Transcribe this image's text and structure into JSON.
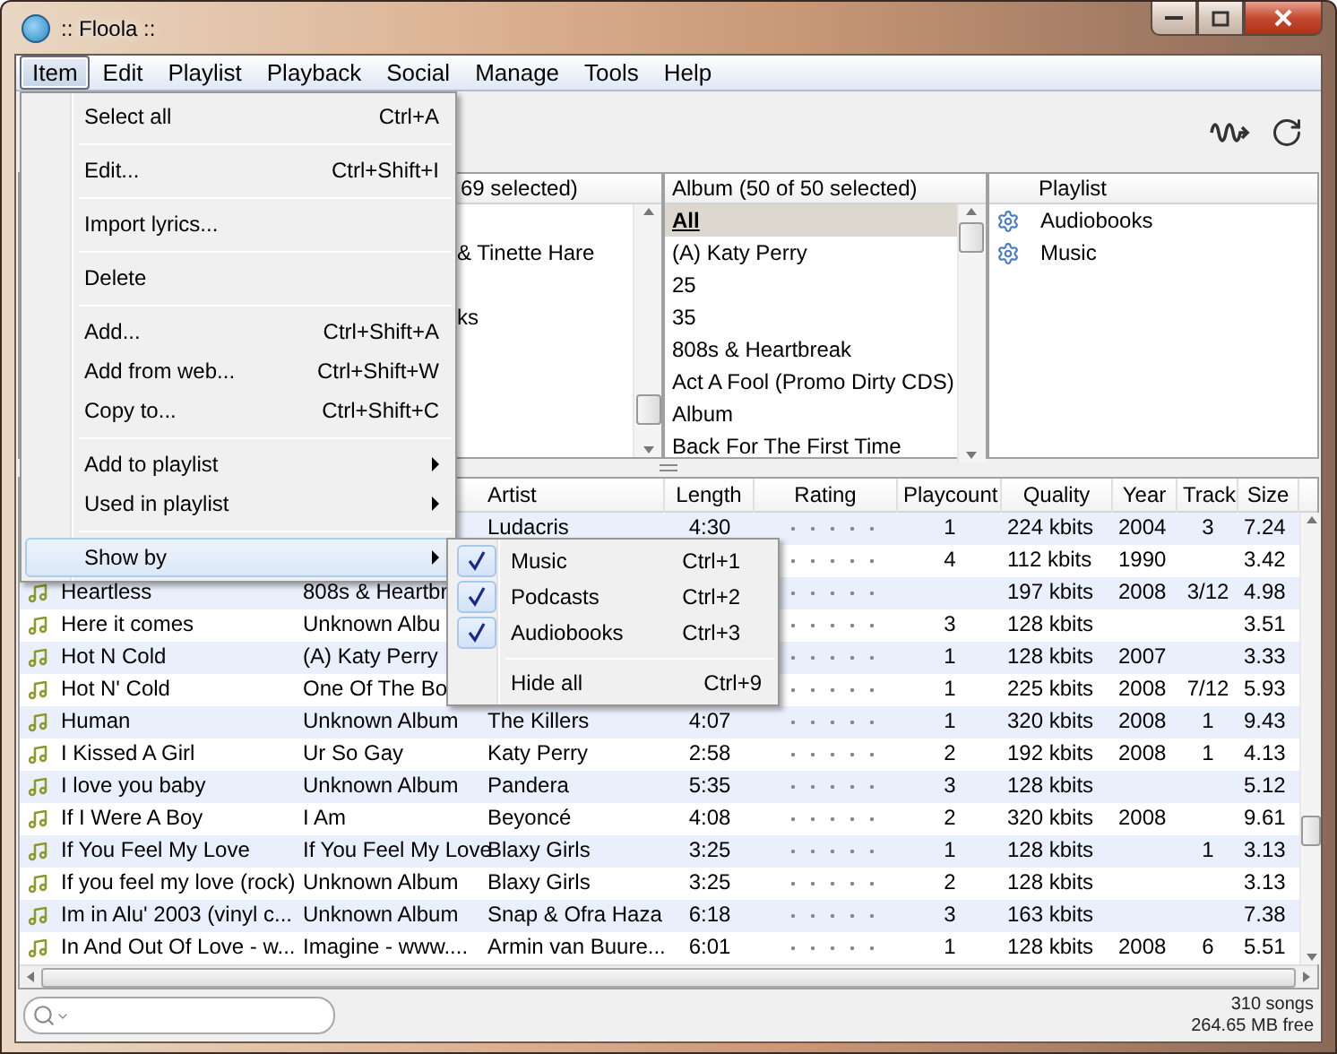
{
  "window": {
    "title": ":: Floola ::"
  },
  "menu_bar": [
    {
      "label": "Item",
      "selected": true
    },
    {
      "label": "Edit",
      "selected": false
    },
    {
      "label": "Playlist",
      "selected": false
    },
    {
      "label": "Playback",
      "selected": false
    },
    {
      "label": "Social",
      "selected": false
    },
    {
      "label": "Manage",
      "selected": false
    },
    {
      "label": "Tools",
      "selected": false
    },
    {
      "label": "Help",
      "selected": false
    }
  ],
  "item_menu": [
    {
      "kind": "item",
      "label": "Select all",
      "shortcut": "Ctrl+A",
      "highlighted": false
    },
    {
      "kind": "separator"
    },
    {
      "kind": "item",
      "label": "Edit...",
      "shortcut": "Ctrl+Shift+I",
      "highlighted": false
    },
    {
      "kind": "separator"
    },
    {
      "kind": "item",
      "label": "Import lyrics...",
      "highlighted": false
    },
    {
      "kind": "separator"
    },
    {
      "kind": "item",
      "label": "Delete",
      "highlighted": false
    },
    {
      "kind": "separator"
    },
    {
      "kind": "item",
      "label": "Add...",
      "shortcut": "Ctrl+Shift+A",
      "highlighted": false
    },
    {
      "kind": "item",
      "label": "Add from web...",
      "shortcut": "Ctrl+Shift+W",
      "highlighted": false
    },
    {
      "kind": "item",
      "label": "Copy to...",
      "shortcut": "Ctrl+Shift+C",
      "highlighted": false
    },
    {
      "kind": "separator"
    },
    {
      "kind": "submenu",
      "label": "Add to playlist",
      "highlighted": false
    },
    {
      "kind": "submenu",
      "label": "Used in playlist",
      "highlighted": false
    },
    {
      "kind": "separator"
    },
    {
      "kind": "submenu",
      "label": "Show by",
      "highlighted": true
    }
  ],
  "show_by_menu": [
    {
      "kind": "check",
      "label": "Music",
      "shortcut": "Ctrl+1",
      "checked": true
    },
    {
      "kind": "check",
      "label": "Podcasts",
      "shortcut": "Ctrl+2",
      "checked": true
    },
    {
      "kind": "check",
      "label": "Audiobooks",
      "shortcut": "Ctrl+3",
      "checked": true
    },
    {
      "kind": "separator"
    },
    {
      "kind": "item",
      "label": "Hide all",
      "shortcut": "Ctrl+9"
    }
  ],
  "artist_pane": {
    "header": "69 selected)",
    "items": [
      {
        "label": "& Tinette Hare"
      },
      {
        "label": "ks"
      }
    ]
  },
  "album_pane": {
    "header": "Album (50 of 50 selected)",
    "items": [
      {
        "label": "All",
        "selected": true
      },
      {
        "label": "(A) Katy Perry",
        "selected": false
      },
      {
        "label": "25",
        "selected": false
      },
      {
        "label": "35",
        "selected": false
      },
      {
        "label": "808s & Heartbreak",
        "selected": false
      },
      {
        "label": "Act A Fool (Promo Dirty CDS)",
        "selected": false
      },
      {
        "label": "Album",
        "selected": false
      },
      {
        "label": "Back For The First Time",
        "selected": false
      }
    ]
  },
  "playlist_pane": {
    "header": "Playlist",
    "items": [
      {
        "label": "Audiobooks"
      },
      {
        "label": "Music"
      }
    ]
  },
  "table": {
    "columns": [
      "Artist",
      "Length",
      "Rating",
      "Playcount",
      "Quality",
      "Year",
      "Track",
      "Size"
    ],
    "rows": [
      {
        "artist": "Ludacris",
        "length": "4:30",
        "playcount": "1",
        "quality": "224 kbits",
        "year": "2004",
        "track": "3",
        "size": "7.24"
      },
      {
        "playcount": "4",
        "quality": "112 kbits",
        "year": "1990",
        "size": "3.42"
      },
      {
        "title": "Heartless",
        "album": "808s & Heartbr",
        "quality": "197 kbits",
        "year": "2008",
        "track": "3/12",
        "size": "4.98"
      },
      {
        "title": "Here it comes",
        "album": "Unknown Albu",
        "playcount": "3",
        "quality": "128 kbits",
        "size": "3.51"
      },
      {
        "title": "Hot N Cold",
        "album": "(A) Katy Perry",
        "playcount": "1",
        "quality": "128 kbits",
        "year": "2007",
        "size": "3.33"
      },
      {
        "title": "Hot N' Cold",
        "album": "One Of The Bo",
        "playcount": "1",
        "quality": "225 kbits",
        "year": "2008",
        "track": "7/12",
        "size": "5.93"
      },
      {
        "title": "Human",
        "album": "Unknown Album",
        "artist": "The Killers",
        "length": "4:07",
        "playcount": "1",
        "quality": "320 kbits",
        "year": "2008",
        "track": "1",
        "size": "9.43"
      },
      {
        "title": "I Kissed A Girl",
        "album": "Ur So Gay",
        "artist": "Katy Perry",
        "length": "2:58",
        "playcount": "2",
        "quality": "192 kbits",
        "year": "2008",
        "track": "1",
        "size": "4.13"
      },
      {
        "title": "I love you baby",
        "album": "Unknown Album",
        "artist": "Pandera",
        "length": "5:35",
        "playcount": "3",
        "quality": "128 kbits",
        "size": "5.12"
      },
      {
        "title": "If I Were A Boy",
        "album": "I Am",
        "artist": "Beyoncé",
        "length": "4:08",
        "playcount": "2",
        "quality": "320 kbits",
        "year": "2008",
        "size": "9.61"
      },
      {
        "title": "If You Feel My Love",
        "album": "If You Feel My Love",
        "artist": "Blaxy Girls",
        "length": "3:25",
        "playcount": "1",
        "quality": "128 kbits",
        "track": "1",
        "size": "3.13"
      },
      {
        "title": "If you feel my love (rock)",
        "album": "Unknown Album",
        "artist": "Blaxy Girls",
        "length": "3:25",
        "playcount": "2",
        "quality": "128 kbits",
        "size": "3.13"
      },
      {
        "title": "Im in Alu' 2003 (vinyl c...",
        "album": "Unknown Album",
        "artist": "Snap & Ofra Haza",
        "length": "6:18",
        "playcount": "3",
        "quality": "163 kbits",
        "size": "7.38"
      },
      {
        "title": "In And Out Of Love - w...",
        "album": "Imagine - www....",
        "artist": "Armin van Buure...",
        "length": "6:01",
        "playcount": "1",
        "quality": "128 kbits",
        "year": "2008",
        "track": "6",
        "size": "5.51"
      }
    ]
  },
  "status": {
    "songs": "310 songs",
    "free": "264.65 MB free"
  }
}
